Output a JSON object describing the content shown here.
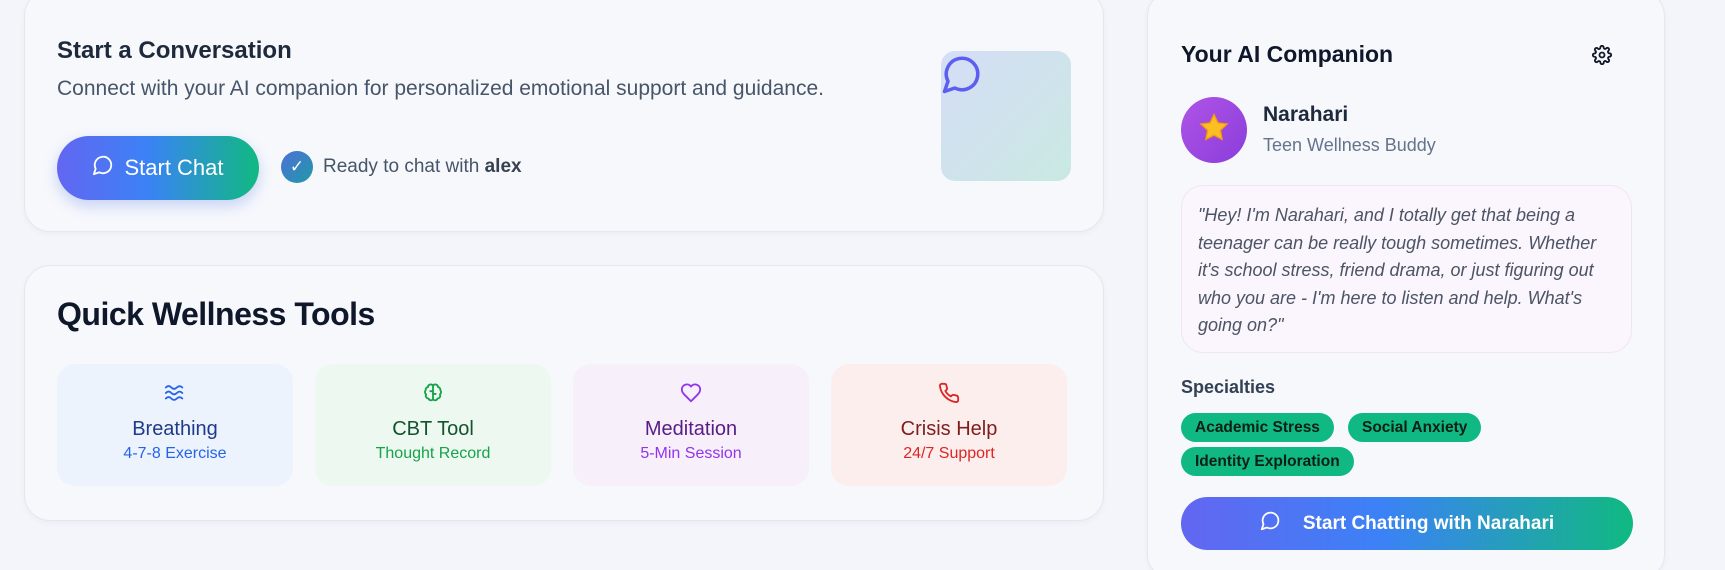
{
  "conversation": {
    "title": "Start a Conversation",
    "subtitle": "Connect with your AI companion for personalized emotional support and guidance.",
    "start_chat_label": "Start Chat",
    "ready_prefix": "Ready to chat with",
    "user_name": "alex"
  },
  "tools": {
    "title": "Quick Wellness Tools",
    "items": [
      {
        "name": "Breathing",
        "sub": "4-7-8 Exercise",
        "icon": "waves-icon"
      },
      {
        "name": "CBT Tool",
        "sub": "Thought Record",
        "icon": "brain-icon"
      },
      {
        "name": "Meditation",
        "sub": "5-Min Session",
        "icon": "heart-icon"
      },
      {
        "name": "Crisis Help",
        "sub": "24/7 Support",
        "icon": "phone-icon"
      }
    ]
  },
  "companion": {
    "title": "Your AI Companion",
    "name": "Narahari",
    "role": "Teen Wellness Buddy",
    "avatar_icon": "star-icon",
    "quote": "\"Hey! I'm Narahari, and I totally get that being a teenager can be really tough sometimes. Whether it's school stress, friend drama, or just figuring out who you are - I'm here to listen and help. What's going on?\"",
    "specialties_title": "Specialties",
    "specialties": [
      "Academic Stress",
      "Social Anxiety",
      "Identity Exploration"
    ],
    "chat_button_label": "Start Chatting with Narahari"
  },
  "colors": {
    "accent_gradient_start": "#6366f1",
    "accent_gradient_end": "#10b981",
    "tag_green": "#10b981",
    "avatar_purple": "#a855f7"
  }
}
